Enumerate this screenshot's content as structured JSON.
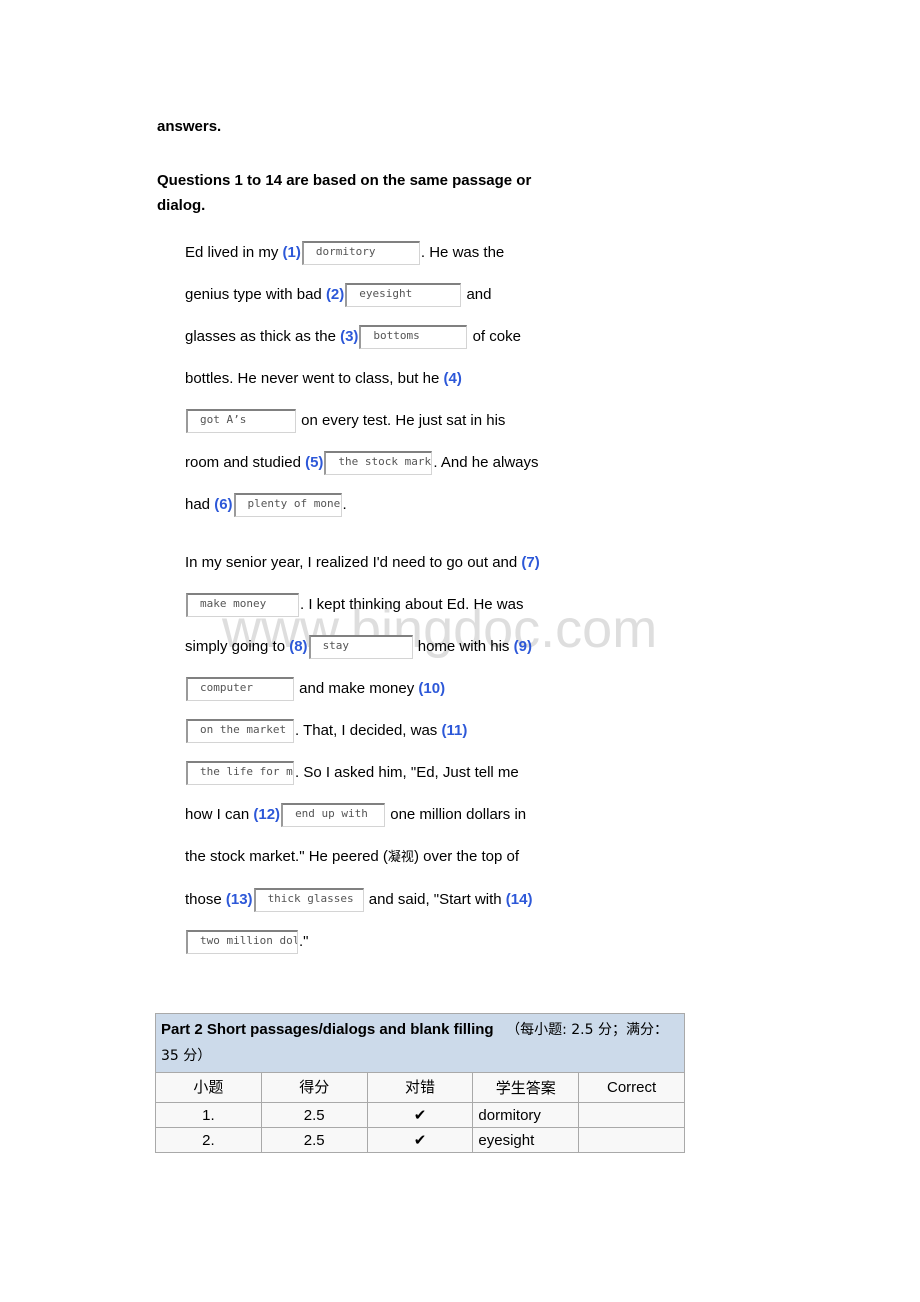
{
  "document": {
    "lead_word": "answers.",
    "question_heading": "Questions 1 to 14 are based on the same passage or dialog.",
    "watermark": "www.bingdoc.com"
  },
  "passage": {
    "paragraph1": {
      "t1": "Ed lived in my ",
      "n1": "(1)",
      "b1": "dormitory",
      "t2": ". He was the genius type with bad ",
      "n2": "(2)",
      "b2": "eyesight",
      "t3": " and glasses as thick as the ",
      "n3": "(3)",
      "b3": "bottoms",
      "t4": " of coke bottles. He never went to class, but he ",
      "n4": "(4)",
      "b4": "got A’s",
      "t5": " on every test. He just sat in his room and studied ",
      "n5": "(5)",
      "b5": "the stock market",
      "t6": ". And he always had ",
      "n6": "(6)",
      "b6": "plenty of money",
      "t7": "."
    },
    "paragraph2": {
      "t1": "In my senior year, I realized I'd need to go out and ",
      "n7": "(7)",
      "b7": "make money",
      "t2": ". I kept thinking about Ed. He was simply going to ",
      "n8": "(8)",
      "b8": "stay",
      "t3": " home with his ",
      "n9": "(9)",
      "b9": "computer",
      "t4": " and make money ",
      "n10": "(10)",
      "b10": "on the market",
      "t5": ". That, I decided, was ",
      "n11": "(11)",
      "b11": "the life for me",
      "t6": ". So I asked him, \"Ed, Just tell me how I can ",
      "n12": "(12)",
      "b12": "end up with",
      "t7": " one million dollars in the stock market.\" He peered (",
      "cn1": "凝视",
      "t8": ") over the top of those ",
      "n13": "(13)",
      "b13": "thick glasses",
      "t9": " and said, \"Start with ",
      "n14": "(14)",
      "b14": "two million dollars",
      "t10": ".\""
    }
  },
  "result_table": {
    "title_en": "Part 2 Short passages/dialogs and blank filling",
    "title_cn": "（每小题: 2.5 分；满分：35 分）",
    "headers": {
      "no": "小题",
      "score": "得分",
      "mark": "对错",
      "student_answer": "学生答案",
      "correct": "Correct"
    },
    "rows": [
      {
        "no": "1.",
        "score": "2.5",
        "mark": "✔",
        "student_answer": "dormitory",
        "correct": ""
      },
      {
        "no": "2.",
        "score": "2.5",
        "mark": "✔",
        "student_answer": "eyesight",
        "correct": ""
      }
    ]
  },
  "colors": {
    "blank_number": "#2d58d8",
    "table_header_bg": "#ccdaea",
    "check_mark": "#2222cc",
    "watermark": "#dedede"
  }
}
